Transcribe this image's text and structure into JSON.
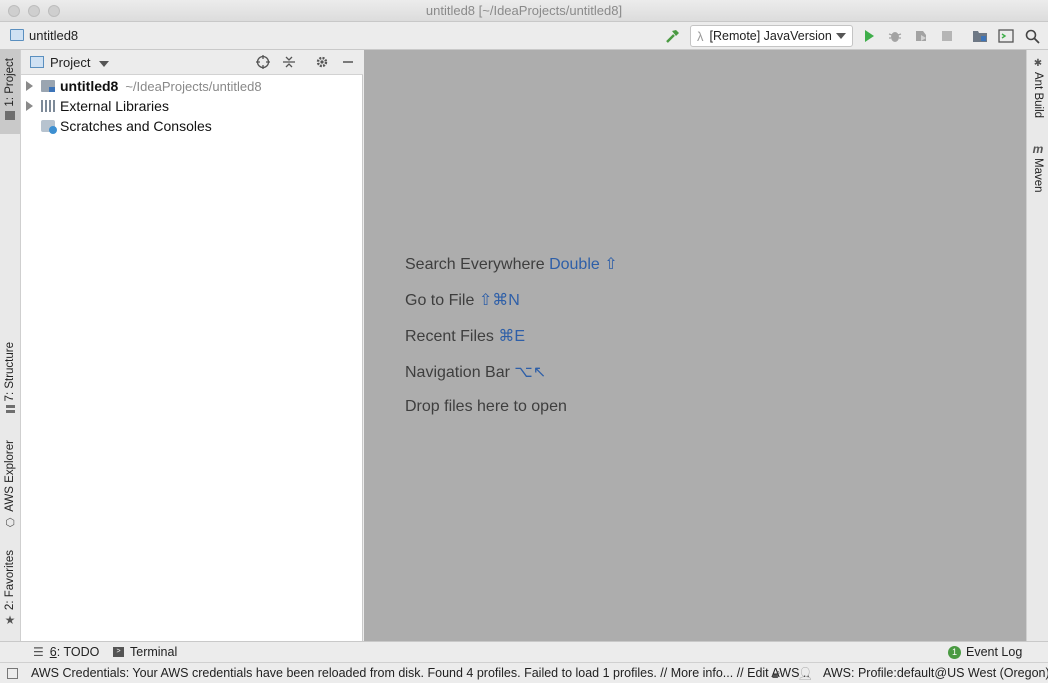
{
  "window": {
    "title": "untitled8 [~/IdeaProjects/untitled8]"
  },
  "navbar": {
    "project": "untitled8",
    "run_config": "[Remote] JavaVersion"
  },
  "left_tabs": {
    "project": "1: Project",
    "structure": "7: Structure",
    "aws_explorer": "AWS Explorer",
    "favorites": "2: Favorites"
  },
  "right_tabs": {
    "ant_build": "Ant Build",
    "maven": "Maven"
  },
  "project_panel": {
    "title": "Project",
    "tree": [
      {
        "name": "untitled8",
        "path": "~/IdeaProjects/untitled8",
        "icon": "folder-icon",
        "expandable": true,
        "bold": true
      },
      {
        "name": "External Libraries",
        "path": "",
        "icon": "library-icon",
        "expandable": true,
        "bold": false
      },
      {
        "name": "Scratches and Consoles",
        "path": "",
        "icon": "scratch-icon",
        "expandable": false,
        "bold": false
      }
    ]
  },
  "editor_hints": [
    {
      "text": "Search Everywhere",
      "key": "Double ⇧"
    },
    {
      "text": "Go to File",
      "key": "⇧⌘N"
    },
    {
      "text": "Recent Files",
      "key": "⌘E"
    },
    {
      "text": "Navigation Bar",
      "key": "⌥↖"
    },
    {
      "text": "Drop files here to open",
      "key": ""
    }
  ],
  "bottom_bar": {
    "todo_num": "6",
    "todo_label": ": TODO",
    "terminal": "Terminal",
    "event_log": "Event Log",
    "event_count": "1"
  },
  "status_bar": {
    "message": "AWS Credentials: Your AWS credentials have been reloaded from disk. Found 4 profiles. Failed to load 1 profiles. // More info... // Edit AWS ..",
    "aws_profile": "AWS: Profile:default@US West (Oregon)"
  },
  "colors": {
    "run_green": "#3fae4a",
    "hammer_green": "#4a9a42",
    "hint_key_blue": "#2e5fa8",
    "editor_bg": "#adadad"
  }
}
